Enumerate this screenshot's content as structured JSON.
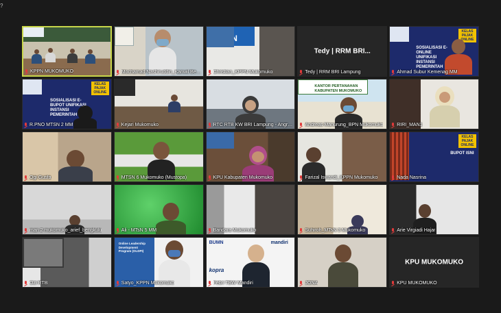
{
  "window": {
    "indicator": "?"
  },
  "tiles": [
    {
      "label": "KPPN MUKOMUKO"
    },
    {
      "label": "Mochamad Nashiruddin_Kanwil Bengkulu"
    },
    {
      "label": "Christian_KPPN Mukomuko",
      "sign": "KPPN"
    },
    {
      "label": "Tedy | RRM BRI Lampung",
      "display": "Tedy | RRM BRI..."
    },
    {
      "label": "Ahmad Subur Kemenag MM",
      "badge": "KELAS PAJAK ONLINE",
      "slide": "SOSIALISASI E-ONLINE UNIFIKASI INSTANSI PEMERINTAH"
    },
    {
      "label": "R.PNO MTSN 2 MM",
      "badge": "KELAS PAJAK ONLINE",
      "slide": "SOSIALISASI E-BUPOT UNIFIKASI INSTANSI PEMERINTAH"
    },
    {
      "label": "Kejari Mukomuko"
    },
    {
      "label": "RTC RTB KW BRI Lampung - Angri Ferita"
    },
    {
      "label": "Andreas Manurung_BPN Mukomuko",
      "sign": "KANTOR PERTANAHAN KABUPATEN MUKOMUKO"
    },
    {
      "label": "RIRI_MAN1"
    },
    {
      "label": "Ogi Gusfa"
    },
    {
      "label": "MTSN 6 Mukomuko (Mustopa)"
    },
    {
      "label": "KPU Kabupaten Mukomuko"
    },
    {
      "label": "Farizal Iswandi_KPPN Mukomuko"
    },
    {
      "label": "Nada Nasrina",
      "badge": "KELAS PAJAK ONLINE",
      "slide": "BUPOT ISNI"
    },
    {
      "label": "man 2 mukomuko_arief_bengkulu"
    },
    {
      "label": "Ali - MTsN 5 MM"
    },
    {
      "label": "Bandara Mukomuko"
    },
    {
      "label": "Suhiroh_MTsN 3 Mukomuko"
    },
    {
      "label": "Arie Virgiadi Hajar"
    },
    {
      "label": "Ozi RTB"
    },
    {
      "label": "Satyo_KPPN Mukomuko",
      "slide": "Online Leadership Development Program (OLDPI)"
    },
    {
      "label": "Febri TBW Mandiri",
      "sign": "BUMN",
      "sign2": "mandiri",
      "sign3": "kopra"
    },
    {
      "label": "JONA"
    },
    {
      "label": "KPU MUKOMUKO",
      "display": "KPU MUKOMUKO"
    }
  ],
  "colors": {
    "background": "#1a1a1a",
    "active_border": "#c8d64a",
    "muted_mic": "#e23b3b",
    "slide_blue": "#1d2a6b",
    "badge_yellow": "#f2c200"
  }
}
